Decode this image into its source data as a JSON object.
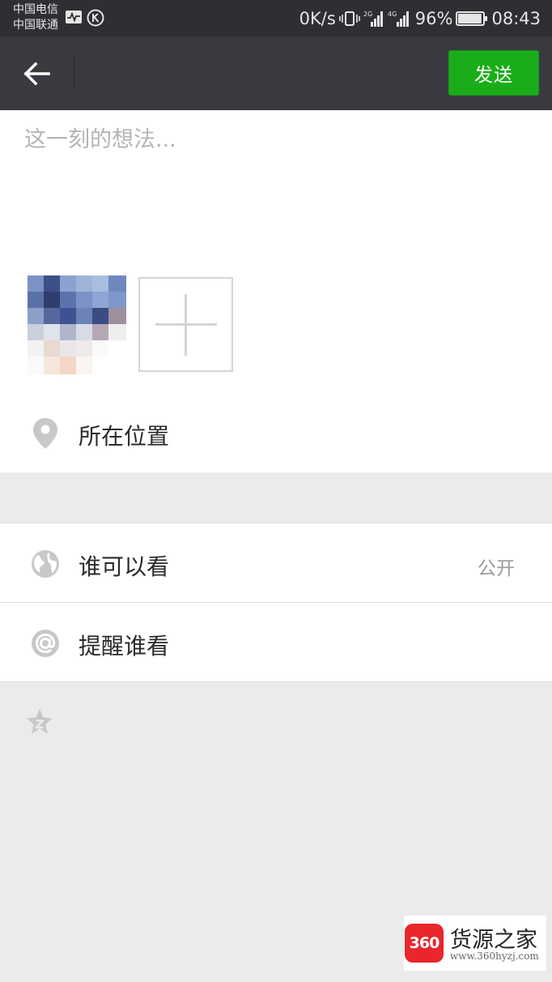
{
  "status_bar": {
    "carrier_1": "中国电信",
    "carrier_2": "中国联通",
    "net_speed": "0K/s",
    "sim1_network": "2G",
    "sim2_network": "4G",
    "battery_level": 0.96,
    "battery_percent": "96%",
    "time": "08:43",
    "icons": [
      "activity-icon",
      "k-app-icon",
      "vibrate-icon",
      "signal-icon",
      "battery-icon"
    ]
  },
  "action_bar": {
    "back_icon": "arrow-left-icon",
    "send_label": "发送"
  },
  "compose": {
    "placeholder": "这一刻的想法...",
    "value": "",
    "location_label": "所在位置",
    "add_photo_icon": "plus-icon"
  },
  "settings": {
    "visibility_label": "谁可以看",
    "visibility_value": "公开",
    "visibility_icon": "globe-icon",
    "mention_label": "提醒谁看",
    "mention_icon": "at-icon",
    "extra_icon": "star-z-icon"
  },
  "watermark": {
    "logo_text": "360",
    "name": "货源之家",
    "url": "www.360hyzj.com"
  },
  "colors": {
    "status_bar_bg": "#2e2f33",
    "action_bar_bg": "#393a3f",
    "send_button_bg": "#1aad19",
    "page_bg": "#ebebeb",
    "panel_bg": "#ffffff",
    "logo_red": "#e8262c"
  }
}
